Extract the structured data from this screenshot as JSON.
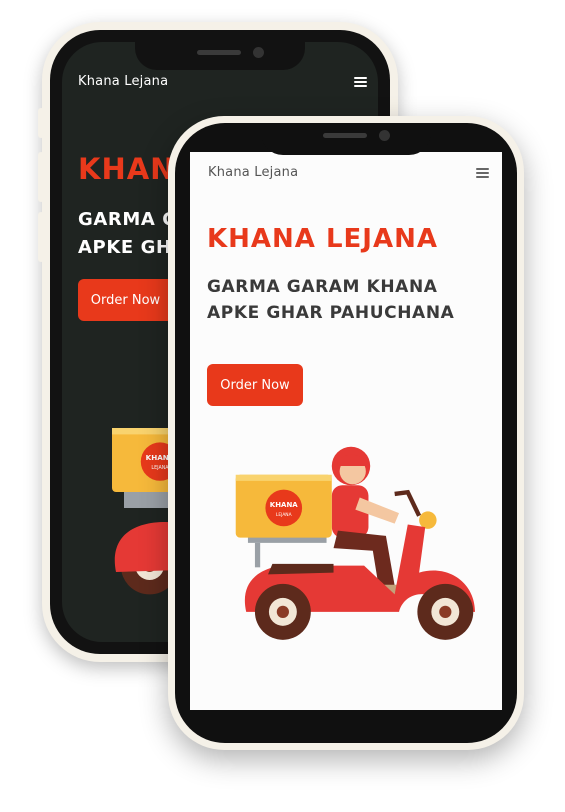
{
  "back_screen": {
    "brand": "Khana Lejana",
    "title": "KHANA LEJANA",
    "tagline_line1": "GARMA GARAM KHANA",
    "tagline_line2": "APKE GHAR PAHUCHANA",
    "cta_label": "Order Now",
    "box_logo_line1": "KHANA",
    "box_logo_line2": "LEJANA",
    "background_color": "#1f2421",
    "text_color": "#ffffff"
  },
  "front_screen": {
    "brand": "Khana Lejana",
    "title": "KHANA LEJANA",
    "tagline_line1": "GARMA GARAM KHANA",
    "tagline_line2": "APKE GHAR PAHUCHANA",
    "cta_label": "Order Now",
    "box_logo_line1": "KHANA",
    "box_logo_line2": "LEJANA",
    "background_color": "#fcfcfc",
    "text_color": "#3a3a3a"
  },
  "colors": {
    "accent": "#e8391b",
    "scooter_red": "#e53935",
    "box_yellow": "#f6b93b",
    "phone_frame": "#f5f1e8"
  },
  "icons": [
    "hamburger-menu-icon",
    "delivery-scooter-illustration"
  ]
}
